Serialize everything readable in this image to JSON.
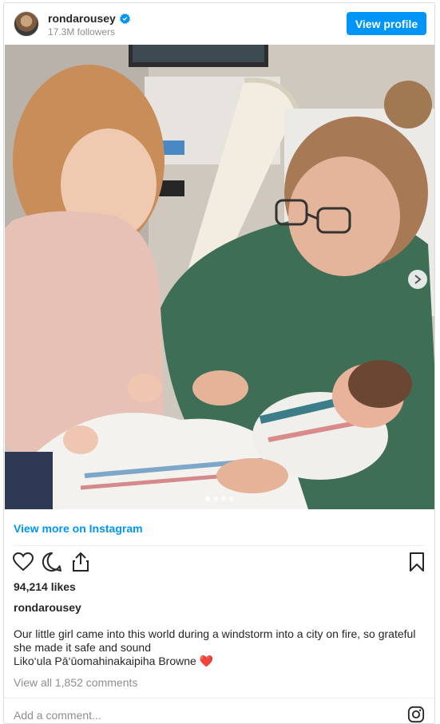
{
  "header": {
    "username": "rondarousey",
    "followers": "17.3M followers",
    "view_profile_label": "View profile"
  },
  "photo": {
    "description_icon": "photo",
    "carousel": {
      "total": 4,
      "active": 1
    }
  },
  "view_more_label": "View more on Instagram",
  "actions": {
    "like_icon": "heart-icon",
    "comment_icon": "comment-icon",
    "share_icon": "share-icon",
    "save_icon": "bookmark-icon"
  },
  "likes": "94,214 likes",
  "author": "rondarousey",
  "caption": {
    "line1": "Our little girl came into this world during a windstorm into a city on fire, so grateful she made it safe and sound",
    "line2": "Liko‘ula Pā‘ūomahinakaipiha Browne",
    "emoji": "❤️"
  },
  "view_comments": "View all 1,852 comments",
  "add_comment_placeholder": "Add a comment...",
  "colors": {
    "accent": "#0095f6",
    "text": "#262626",
    "muted": "#8e8e8e"
  }
}
